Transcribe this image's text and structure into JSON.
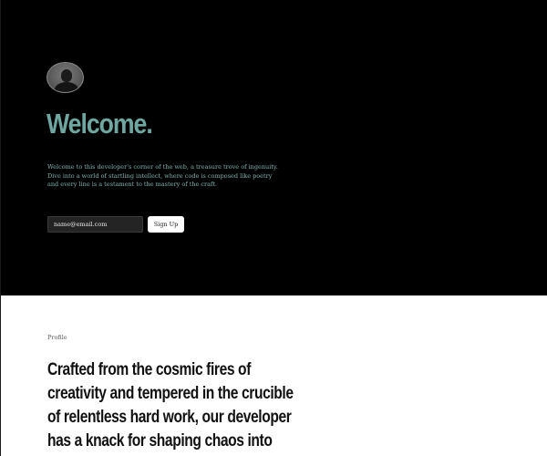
{
  "hero": {
    "avatar_alt": "developer avatar",
    "title": "Welcome.",
    "intro": "Welcome to this developer's corner of the web, a treasure trove of ingenuity. Dive into a world of startling intellect, where code is composed like poetry and every line is a testament to the mastery of the craft.",
    "form": {
      "email_placeholder": "name@email.com",
      "signup_label": "Sign Up"
    },
    "colors": {
      "background": "#000000",
      "accent": "#6fa7a0"
    }
  },
  "profile": {
    "label": "Profile",
    "heading": "Crafted from the cosmic fires of creativity and tempered in the crucible of relentless hard work, our developer has a knack for shaping chaos into order."
  }
}
